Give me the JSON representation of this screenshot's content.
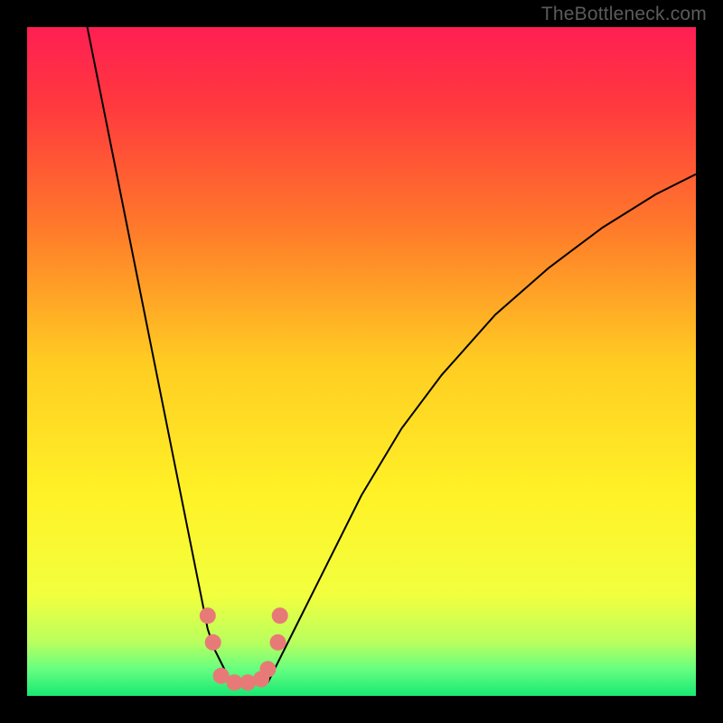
{
  "watermark": "TheBottleneck.com",
  "chart_data": {
    "type": "line",
    "title": "",
    "xlabel": "",
    "ylabel": "",
    "xlim": [
      0,
      100
    ],
    "ylim": [
      0,
      100
    ],
    "series": [
      {
        "name": "curve-left",
        "x": [
          9,
          11,
          13,
          15,
          17,
          19,
          21,
          23,
          25,
          26,
          27,
          28,
          29,
          30,
          31
        ],
        "y": [
          100,
          90,
          80,
          70,
          60,
          50,
          40,
          30,
          20,
          15,
          10,
          7,
          5,
          3,
          2
        ]
      },
      {
        "name": "curve-right",
        "x": [
          36,
          38,
          40,
          44,
          50,
          56,
          62,
          70,
          78,
          86,
          94,
          100
        ],
        "y": [
          2,
          6,
          10,
          18,
          30,
          40,
          48,
          57,
          64,
          70,
          75,
          78
        ]
      },
      {
        "name": "marker-cluster",
        "x": [
          27,
          27.8,
          29,
          31,
          33,
          35,
          36,
          37.5,
          37.8
        ],
        "y": [
          12,
          8,
          3,
          2,
          2,
          2.5,
          4,
          8,
          12
        ]
      }
    ],
    "gradient_stops": [
      {
        "pos": 0.0,
        "color": "#ff1f53"
      },
      {
        "pos": 0.12,
        "color": "#ff3a3e"
      },
      {
        "pos": 0.3,
        "color": "#ff7a2a"
      },
      {
        "pos": 0.5,
        "color": "#ffcc22"
      },
      {
        "pos": 0.7,
        "color": "#fff227"
      },
      {
        "pos": 0.85,
        "color": "#f2ff3e"
      },
      {
        "pos": 0.92,
        "color": "#b9ff5e"
      },
      {
        "pos": 0.96,
        "color": "#66ff80"
      },
      {
        "pos": 1.0,
        "color": "#18e873"
      }
    ],
    "marker_color": "#e77a77"
  }
}
